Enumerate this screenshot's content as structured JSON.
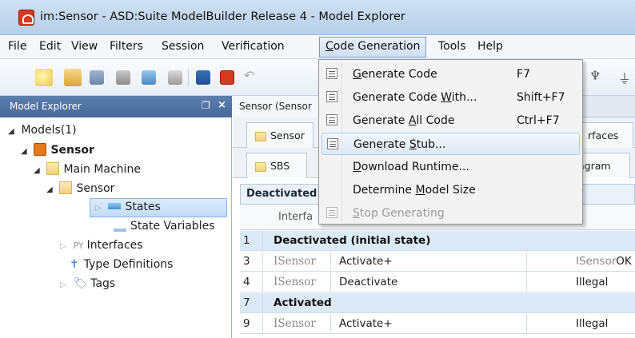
{
  "window": {
    "title": "im:Sensor - ASD:Suite ModelBuilder Release 4 - Model Explorer"
  },
  "menubar": {
    "items": [
      "File",
      "Edit",
      "View",
      "Filters",
      "Session",
      "Verification",
      "Code Generation",
      "Tools",
      "Help"
    ],
    "active": "Code Generation"
  },
  "dropdown": {
    "items": [
      {
        "pre": "",
        "u": "G",
        "post": "enerate Code",
        "shortcut": "F7",
        "enabled": true
      },
      {
        "pre": "Generate Code ",
        "u": "W",
        "post": "ith...",
        "shortcut": "Shift+F7",
        "enabled": true
      },
      {
        "pre": "Generate ",
        "u": "A",
        "post": "ll Code",
        "shortcut": "Ctrl+F7",
        "enabled": true
      },
      {
        "pre": "Generate ",
        "u": "S",
        "post": "tub...",
        "shortcut": "",
        "enabled": true,
        "highlighted": true
      },
      {
        "pre": "",
        "u": "D",
        "post": "ownload Runtime...",
        "shortcut": "",
        "enabled": true
      },
      {
        "pre": "Determine ",
        "u": "M",
        "post": "odel Size",
        "shortcut": "",
        "enabled": true
      },
      {
        "pre": "",
        "u": "S",
        "post": "top Generating",
        "shortcut": "",
        "enabled": false
      }
    ]
  },
  "explorer": {
    "title": "Model Explorer",
    "tree": {
      "models": "Models(1)",
      "sensor_root": "Sensor",
      "main_machine": "Main Machine",
      "sensor_child": "Sensor",
      "states": "States",
      "state_variables": "State Variables",
      "interfaces": "Interfaces",
      "type_definitions": "Type Definitions",
      "tags": "Tags"
    }
  },
  "document": {
    "tab_title": "Sensor (Sensor",
    "subtab_sensor": "Sensor",
    "subtab_interfaces": "rfaces",
    "subtab_sbs": "SBS",
    "subtab_diagram": "agram",
    "state_header": "Deactivated",
    "col_interface": "Interfa"
  },
  "grid": {
    "rows": [
      {
        "num": "1",
        "kind": "state",
        "label": "Deactivated (initial state)"
      },
      {
        "num": "3",
        "kind": "event",
        "iface": "ISensor",
        "event": "Activate+",
        "target": "ISensor",
        "target2": "OK"
      },
      {
        "num": "4",
        "kind": "event",
        "iface": "ISensor",
        "event": "Deactivate",
        "target": "Illegal",
        "target2": ""
      },
      {
        "num": "7",
        "kind": "state",
        "label": "Activated"
      },
      {
        "num": "9",
        "kind": "event",
        "iface": "ISensor",
        "event": "Activate+",
        "target": "Illegal",
        "target2": ""
      }
    ]
  }
}
